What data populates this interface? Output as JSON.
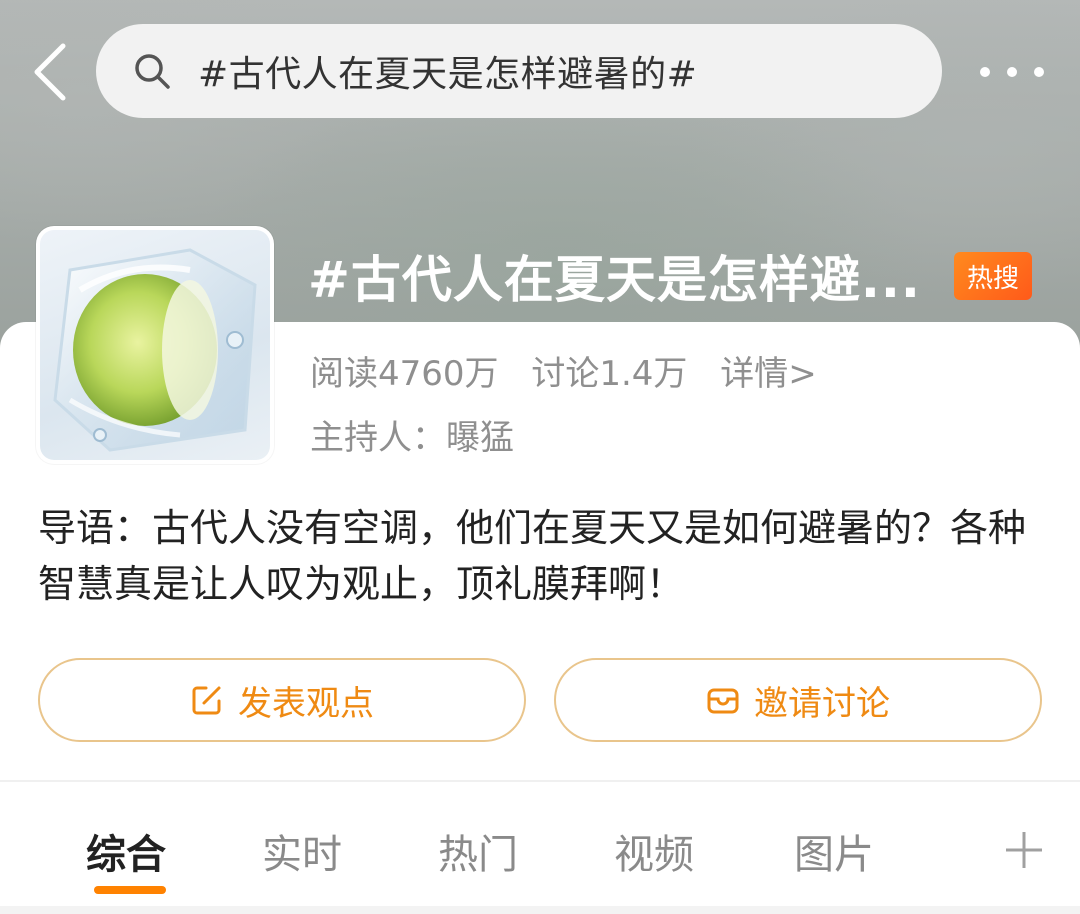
{
  "search": {
    "query": "#古代人在夏天是怎样避暑的#"
  },
  "topic": {
    "title": "#古代人在夏天是怎样避...",
    "badge": "热搜",
    "reads": "阅读4760万",
    "discussions": "讨论1.4万",
    "details_link": "详情>",
    "host": "主持人：曝猛",
    "intro": "导语：古代人没有空调，他们在夏天又是如何避暑的？各种智慧真是让人叹为观止，顶礼膜拜啊！"
  },
  "actions": {
    "post_label": "发表观点",
    "invite_label": "邀请讨论"
  },
  "tabs": [
    {
      "label": "综合",
      "active": true
    },
    {
      "label": "实时",
      "active": false
    },
    {
      "label": "热门",
      "active": false
    },
    {
      "label": "视频",
      "active": false
    },
    {
      "label": "图片",
      "active": false
    }
  ],
  "colors": {
    "accent": "#ff8200",
    "badge": "#ff6a1a",
    "button_border": "#e9c58c"
  },
  "icons": [
    "back-arrow-icon",
    "search-icon",
    "more-icon",
    "edit-icon",
    "invite-icon",
    "plus-icon"
  ]
}
